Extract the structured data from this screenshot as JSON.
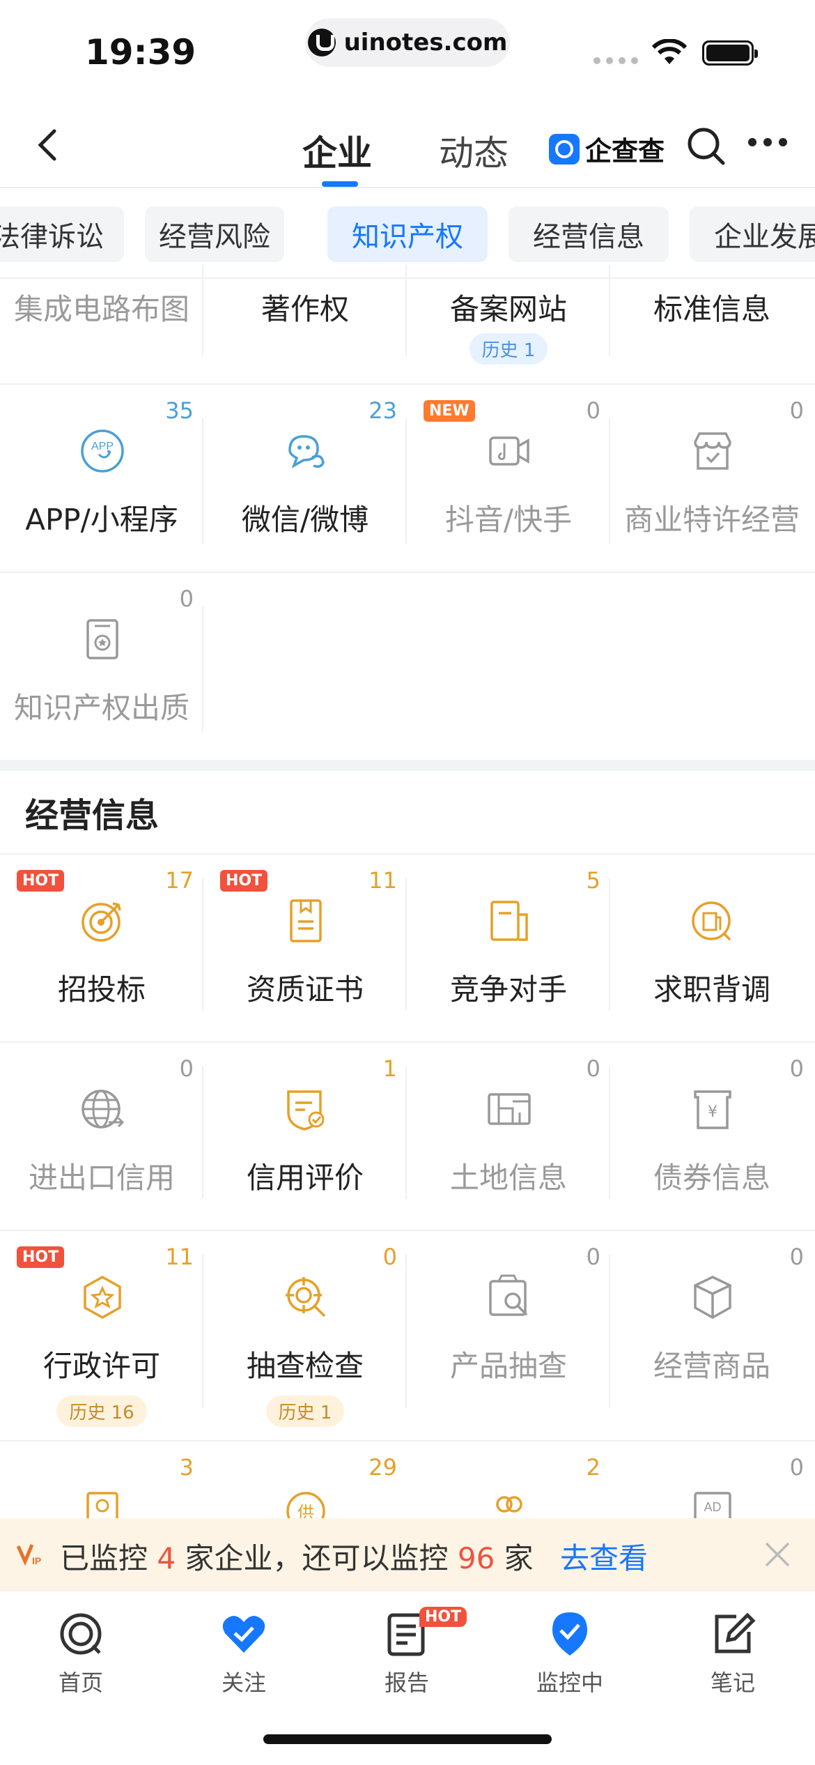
{
  "status": {
    "time": "19:39",
    "url": "uinotes.com"
  },
  "nav": {
    "tabs": [
      "企业",
      "动态"
    ],
    "brand": "企查查"
  },
  "chips": [
    "法律诉讼",
    "经营风险",
    "知识产权",
    "经营信息",
    "企业发展"
  ],
  "ip_section": {
    "top_row": [
      {
        "label": "集成电路布图",
        "style": "gray"
      },
      {
        "label": "著作权",
        "style": "dark"
      },
      {
        "label": "备案网站",
        "style": "dark",
        "history": "历史 1"
      },
      {
        "label": "标准信息",
        "style": "dark"
      }
    ],
    "row2": [
      {
        "label": "APP/小程序",
        "count": "35",
        "style": "dark",
        "icon": "app-icon"
      },
      {
        "label": "微信/微博",
        "count": "23",
        "style": "dark",
        "icon": "wechat-weibo-icon"
      },
      {
        "label": "抖音/快手",
        "count": "0",
        "style": "gray",
        "icon": "video-icon",
        "badge": "NEW"
      },
      {
        "label": "商业特许经营",
        "count": "0",
        "style": "gray",
        "icon": "store-icon"
      }
    ],
    "row3": [
      {
        "label": "知识产权出质",
        "count": "0",
        "style": "gray",
        "icon": "certificate-icon"
      }
    ]
  },
  "biz_section": {
    "title": "经营信息",
    "row1": [
      {
        "label": "招投标",
        "count": "17",
        "badge": "HOT",
        "icon": "target-icon"
      },
      {
        "label": "资质证书",
        "count": "11",
        "badge": "HOT",
        "icon": "document-icon"
      },
      {
        "label": "竞争对手",
        "count": "5",
        "icon": "competitor-icon"
      },
      {
        "label": "求职背调",
        "count": "",
        "icon": "job-search-icon"
      }
    ],
    "row2": [
      {
        "label": "进出口信用",
        "count": "0",
        "style": "gray",
        "icon": "globe-icon"
      },
      {
        "label": "信用评价",
        "count": "1",
        "style": "dark",
        "icon": "shield-check-icon"
      },
      {
        "label": "土地信息",
        "count": "0",
        "style": "gray",
        "icon": "land-icon"
      },
      {
        "label": "债券信息",
        "count": "0",
        "style": "gray",
        "icon": "bond-icon"
      }
    ],
    "row3": [
      {
        "label": "行政许可",
        "count": "11",
        "badge": "HOT",
        "style": "dark",
        "icon": "star-hexagon-icon",
        "history": "历史 16"
      },
      {
        "label": "抽查检查",
        "count": "0",
        "style": "dark",
        "icon": "inspect-icon",
        "history": "历史 1"
      },
      {
        "label": "产品抽查",
        "count": "0",
        "style": "gray",
        "icon": "product-check-icon"
      },
      {
        "label": "经营商品",
        "count": "0",
        "style": "gray",
        "icon": "box-icon"
      }
    ],
    "row4_counts": [
      "3",
      "29",
      "2",
      "0"
    ]
  },
  "monitor": {
    "pre": "已监控",
    "count1": "4",
    "mid": "家企业，还可以监控",
    "count2": "96",
    "post": "家",
    "link": "去查看"
  },
  "tabbar": [
    {
      "label": "首页",
      "icon": "home-icon"
    },
    {
      "label": "关注",
      "icon": "heart-icon"
    },
    {
      "label": "报告",
      "icon": "report-icon",
      "badge": "HOT"
    },
    {
      "label": "监控中",
      "icon": "monitor-icon"
    },
    {
      "label": "笔记",
      "icon": "note-icon"
    }
  ],
  "colors": {
    "accent": "#1677ff",
    "orange": "#e6a028",
    "blue_icon": "#4a9fd8",
    "hot": "#f0523d"
  }
}
